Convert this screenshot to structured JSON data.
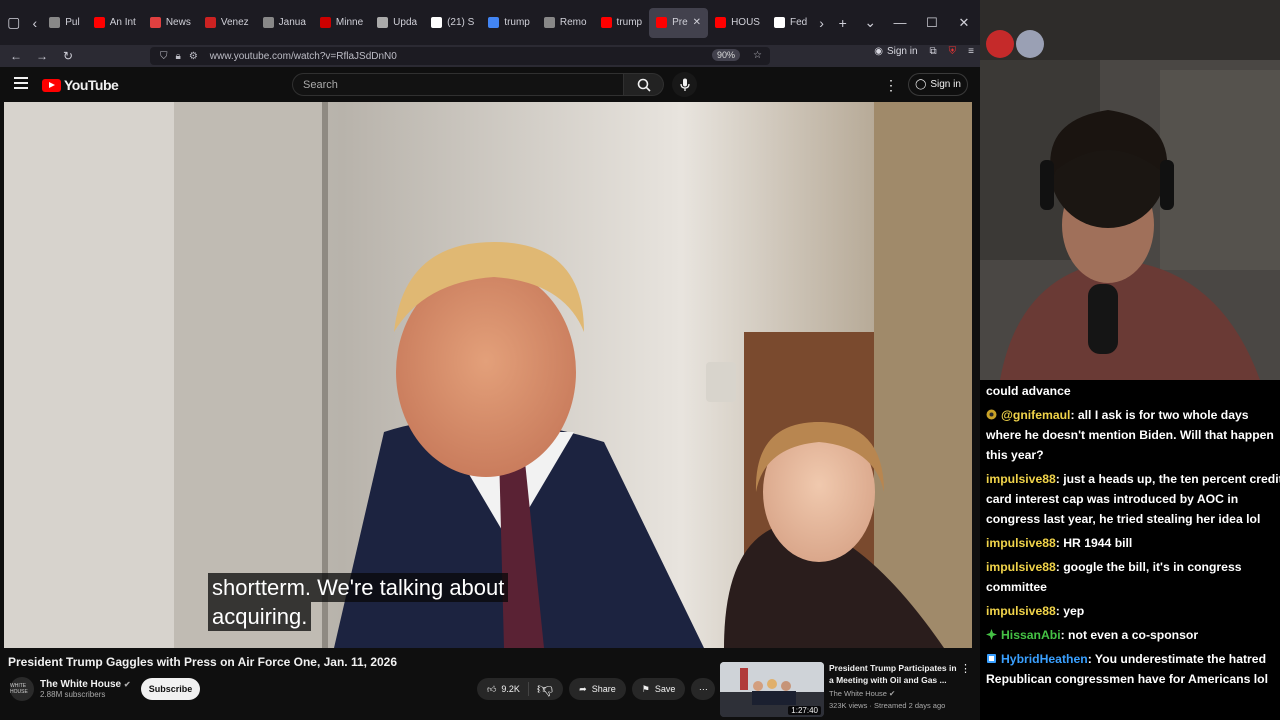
{
  "browser": {
    "tabs": [
      {
        "label": "Pul",
        "color": "#888888"
      },
      {
        "label": "An Int",
        "color": "#ff0000"
      },
      {
        "label": "News",
        "color": "#e04040"
      },
      {
        "label": "Venez",
        "color": "#cc2222"
      },
      {
        "label": "Janua",
        "color": "#888888"
      },
      {
        "label": "Minne",
        "color": "#cc0000"
      },
      {
        "label": "Upda",
        "color": "#aaaaaa"
      },
      {
        "label": "(21) S",
        "color": "#ffffff"
      },
      {
        "label": "trump",
        "color": "#4285f4"
      },
      {
        "label": "Remo",
        "color": "#888888"
      },
      {
        "label": "trump",
        "color": "#ff0000"
      },
      {
        "label": "Pre",
        "color": "#ff0000"
      },
      {
        "label": "HOUS",
        "color": "#ff0000"
      },
      {
        "label": "Fed",
        "color": "#ffffff"
      }
    ],
    "url": "www.youtube.com/watch?v=RflaJSdDnN0",
    "zoom": "90%",
    "signin": "Sign in"
  },
  "youtube": {
    "logo": "YouTube",
    "search_placeholder": "Search",
    "signin": "Sign in",
    "caption_lines": [
      "shortterm. We're talking about",
      "acquiring."
    ],
    "title": "President Trump Gaggles with Press on Air Force One, Jan. 11, 2026",
    "channel": "The White House",
    "subscribers": "2.88M subscribers",
    "avatar_text": "WHITE HOUSE",
    "subscribe": "Subscribe",
    "likes": "9.2K",
    "share": "Share",
    "save": "Save",
    "recommended": {
      "title": "President Trump Participates in a Meeting with Oil and Gas ...",
      "channel": "The White House",
      "meta": "323K views · Streamed 2 days ago",
      "duration": "1:27:40"
    }
  },
  "chat": [
    {
      "user": "",
      "text": "could advance",
      "color": "#ffffff"
    },
    {
      "user": "@gnifemaul",
      "text": ": all I ask is for two whole days where he doesn't mention Biden. Will that happen this year?",
      "color": "#f0d34a"
    },
    {
      "user": "impulsive88",
      "text": ": just a heads up, the ten percent credit card interest cap was introduced by AOC in congress last year, he tried stealing her idea lol",
      "color": "#f0d34a"
    },
    {
      "user": "impulsive88",
      "text": ": HR 1944 bill",
      "color": "#f0d34a"
    },
    {
      "user": "impulsive88",
      "text": ": google the bill, it's in congress committee",
      "color": "#f0d34a"
    },
    {
      "user": "impulsive88",
      "text": ": yep",
      "color": "#f0d34a"
    },
    {
      "user": "HissanAbi",
      "text": ": not even a co-sponsor",
      "color": "#45c245"
    },
    {
      "user": "HybridHeathen",
      "text": ": You underestimate the hatred Republican congressmen have for Americans lol",
      "color": "#3aa0ff"
    }
  ]
}
